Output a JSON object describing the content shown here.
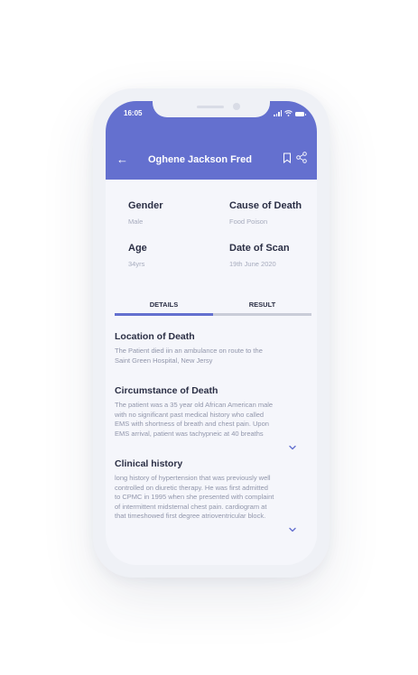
{
  "status_bar": {
    "time": "16:05"
  },
  "header": {
    "title": "Oghene Jackson Fred",
    "back_icon": "arrow-left-icon",
    "bookmark_icon": "bookmark-icon",
    "share_icon": "share-icon"
  },
  "details": {
    "gender": {
      "label": "Gender",
      "value": "Male"
    },
    "cause": {
      "label": "Cause of Death",
      "value": "Food Poison"
    },
    "age": {
      "label": "Age",
      "value": "34yrs"
    },
    "scan_date": {
      "label": "Date of Scan",
      "value": "19th June 2020"
    }
  },
  "tabs": [
    {
      "label": "DETAILS",
      "active": true
    },
    {
      "label": "RESULT",
      "active": false
    }
  ],
  "sections": {
    "location": {
      "title": "Location of Death",
      "body": "The Patient died iin an ambulance on route to the\nSaint Green Hospital, New Jersy"
    },
    "circumstance": {
      "title": "Circumstance of Death",
      "body": "The patient was a 35 year old African American male\nwith no significant past medical history who called\nEMS with shortness of breath and chest pain. Upon\nEMS arrival, patient was tachypneic at 40 breaths"
    },
    "clinical": {
      "title": "Clinical history",
      "body": "long history of hypertension that was previously well\ncontrolled on diuretic therapy. He was first admitted\nto CPMC in 1995 when she presented with complaint\nof intermittent midsternal chest pain. cardiogram at\nthat timeshowed first  degree atrioventricular block."
    }
  },
  "colors": {
    "accent": "#6470cf",
    "text_dark": "#2b2f45",
    "text_muted": "#9196ab",
    "tab_inactive": "#c9ccd8"
  }
}
